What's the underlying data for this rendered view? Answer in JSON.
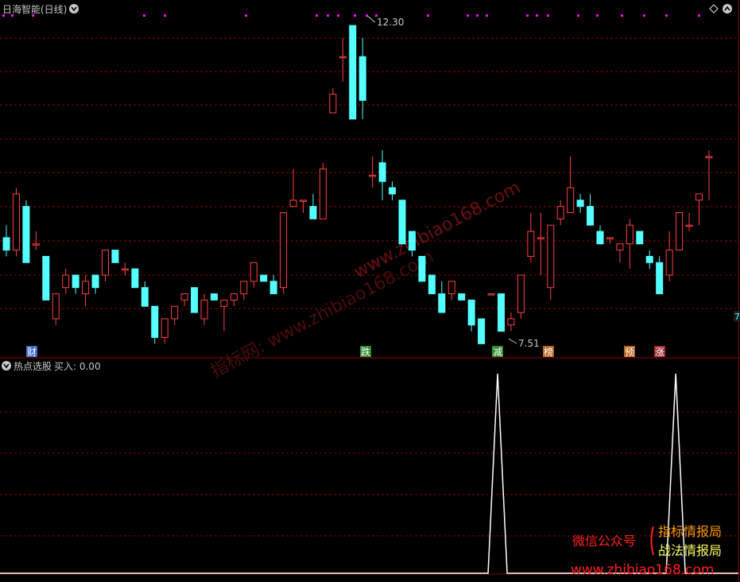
{
  "top_pane": {
    "title": "日海智能(日线)",
    "high_label": "12.30",
    "low_label": "7.51",
    "right_edge_label": "7"
  },
  "bottom_pane": {
    "title": "热点选股",
    "indicator_label": "买入: 0.00"
  },
  "event_markers": [
    {
      "label": "财",
      "color": "#3c6cc8",
      "text_color": "#ffffff"
    },
    {
      "label": "跌",
      "color": "#2f8a2f",
      "text_color": "#ffffff"
    },
    {
      "label": "减",
      "color": "#2f8a2f",
      "text_color": "#ffffff"
    },
    {
      "label": "榜",
      "color": "#b5651d",
      "text_color": "#ffffff"
    },
    {
      "label": "预",
      "color": "#b5651d",
      "text_color": "#ffffff"
    },
    {
      "label": "涨",
      "color": "#a02a2a",
      "text_color": "#ffffff"
    }
  ],
  "watermarks": {
    "diag1": "www.zhibiao168.com",
    "diag2": "指标网: www.zhibiao168.com",
    "promo_left": "微信公众号",
    "promo_right1": "指标情报局",
    "promo_right2": "战法情报局",
    "promo_url": "www.zhibiao168.com"
  },
  "colors": {
    "up": "#ff4040",
    "down": "#54ffff",
    "grid": "#8b0000",
    "signal": "#ffffff",
    "top_markers": "#ff00ff"
  },
  "chart_data": {
    "type": "candlestick",
    "y_max": 12.3,
    "y_min": 7.51,
    "candles": [
      [
        8.9,
        9.1,
        8.6,
        8.7
      ],
      [
        8.7,
        9.7,
        8.6,
        9.6
      ],
      [
        9.4,
        9.5,
        8.5,
        8.5
      ],
      [
        8.8,
        9.0,
        8.7,
        8.8
      ],
      [
        8.6,
        8.6,
        7.9,
        7.9
      ],
      [
        7.6,
        8.0,
        7.5,
        8.0
      ],
      [
        8.1,
        8.4,
        8.0,
        8.3
      ],
      [
        8.3,
        8.3,
        8.0,
        8.1
      ],
      [
        8.0,
        8.3,
        7.8,
        8.2
      ],
      [
        8.3,
        8.3,
        8.0,
        8.1
      ],
      [
        8.3,
        8.7,
        8.2,
        8.7
      ],
      [
        8.7,
        8.7,
        8.5,
        8.5
      ],
      [
        8.4,
        8.5,
        8.3,
        8.4
      ],
      [
        8.4,
        8.4,
        8.1,
        8.1
      ],
      [
        8.1,
        8.2,
        7.8,
        7.8
      ],
      [
        7.8,
        7.8,
        7.2,
        7.3
      ],
      [
        7.3,
        7.6,
        7.2,
        7.6
      ],
      [
        7.6,
        7.8,
        7.5,
        7.8
      ],
      [
        7.9,
        8.0,
        7.8,
        8.0
      ],
      [
        8.1,
        8.1,
        7.7,
        7.7
      ],
      [
        7.6,
        8.0,
        7.5,
        7.9
      ],
      [
        8.0,
        8.0,
        7.9,
        7.9
      ],
      [
        7.8,
        7.9,
        7.4,
        7.9
      ],
      [
        7.9,
        8.0,
        7.8,
        8.0
      ],
      [
        8.0,
        8.2,
        7.9,
        8.2
      ],
      [
        8.2,
        8.5,
        8.1,
        8.5
      ],
      [
        8.3,
        8.3,
        8.2,
        8.2
      ],
      [
        8.2,
        8.3,
        8.1,
        8.0
      ],
      [
        8.1,
        9.3,
        8.0,
        9.3
      ],
      [
        9.4,
        10.0,
        9.4,
        9.5
      ],
      [
        9.5,
        9.5,
        9.3,
        9.5
      ],
      [
        9.4,
        9.6,
        9.4,
        9.2
      ],
      [
        9.2,
        10.1,
        9.2,
        10.0
      ],
      [
        10.9,
        11.3,
        10.9,
        11.2
      ],
      [
        11.8,
        12.1,
        11.4,
        11.8
      ],
      [
        12.3,
        12.3,
        11.4,
        10.8
      ],
      [
        11.8,
        12.1,
        10.8,
        11.1
      ],
      [
        9.9,
        10.2,
        9.7,
        9.9
      ],
      [
        10.1,
        10.3,
        9.5,
        9.8
      ],
      [
        9.7,
        9.8,
        9.5,
        9.6
      ],
      [
        9.5,
        9.5,
        9.0,
        8.8
      ],
      [
        9.0,
        9.0,
        8.6,
        8.7
      ],
      [
        8.6,
        8.6,
        8.3,
        8.2
      ],
      [
        8.3,
        8.3,
        8.0,
        8.0
      ],
      [
        8.0,
        8.2,
        7.7,
        7.7
      ],
      [
        8.0,
        8.1,
        7.9,
        8.2
      ],
      [
        8.0,
        8.0,
        7.9,
        7.9
      ],
      [
        7.9,
        7.9,
        7.4,
        7.5
      ],
      [
        7.6,
        7.6,
        7.3,
        7.2
      ],
      [
        8.0,
        8.0,
        8.0,
        8.0
      ],
      [
        8.0,
        8.0,
        7.4,
        7.4
      ],
      [
        7.5,
        7.7,
        7.4,
        7.6
      ],
      [
        7.7,
        8.3,
        7.6,
        8.3
      ],
      [
        8.6,
        9.3,
        8.5,
        9.0
      ],
      [
        8.9,
        9.3,
        8.3,
        8.9
      ],
      [
        8.1,
        9.0,
        7.9,
        9.1
      ],
      [
        9.2,
        9.5,
        9.1,
        9.4
      ],
      [
        9.3,
        10.2,
        9.3,
        9.7
      ],
      [
        9.5,
        9.6,
        9.3,
        9.4
      ],
      [
        9.4,
        9.6,
        9.3,
        9.1
      ],
      [
        9.0,
        9.1,
        8.8,
        8.8
      ],
      [
        8.9,
        8.9,
        8.8,
        8.9
      ],
      [
        8.7,
        8.8,
        8.5,
        8.8
      ],
      [
        8.8,
        9.2,
        8.4,
        9.1
      ],
      [
        9.0,
        9.0,
        8.8,
        8.8
      ],
      [
        8.6,
        8.7,
        8.4,
        8.5
      ],
      [
        8.5,
        8.6,
        8.0,
        8.0
      ],
      [
        8.3,
        9.0,
        8.2,
        8.7
      ],
      [
        8.7,
        9.3,
        8.7,
        9.3
      ],
      [
        9.1,
        9.3,
        9.0,
        9.1
      ],
      [
        9.5,
        9.6,
        9.1,
        9.6
      ],
      [
        10.2,
        10.3,
        9.5,
        10.2
      ]
    ],
    "signal_spikes": [
      49,
      67
    ]
  }
}
